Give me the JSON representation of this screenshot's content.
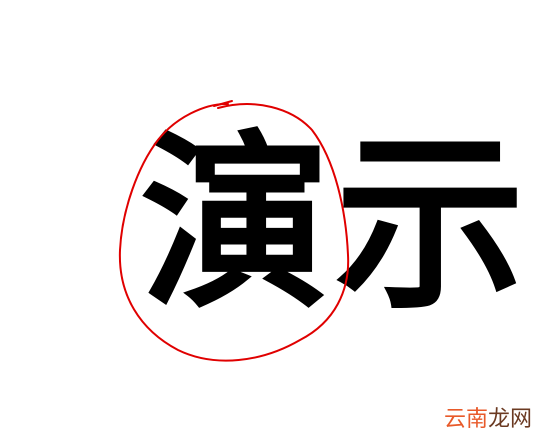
{
  "text": {
    "first_char": "演",
    "second_char": "示"
  },
  "watermark": {
    "part1": "云南",
    "part2": "龙网"
  },
  "colors": {
    "ink": "#000000",
    "circle_stroke": "#e00000",
    "watermark_part1": "#e85a2a",
    "watermark_part2": "#6b3a22"
  }
}
